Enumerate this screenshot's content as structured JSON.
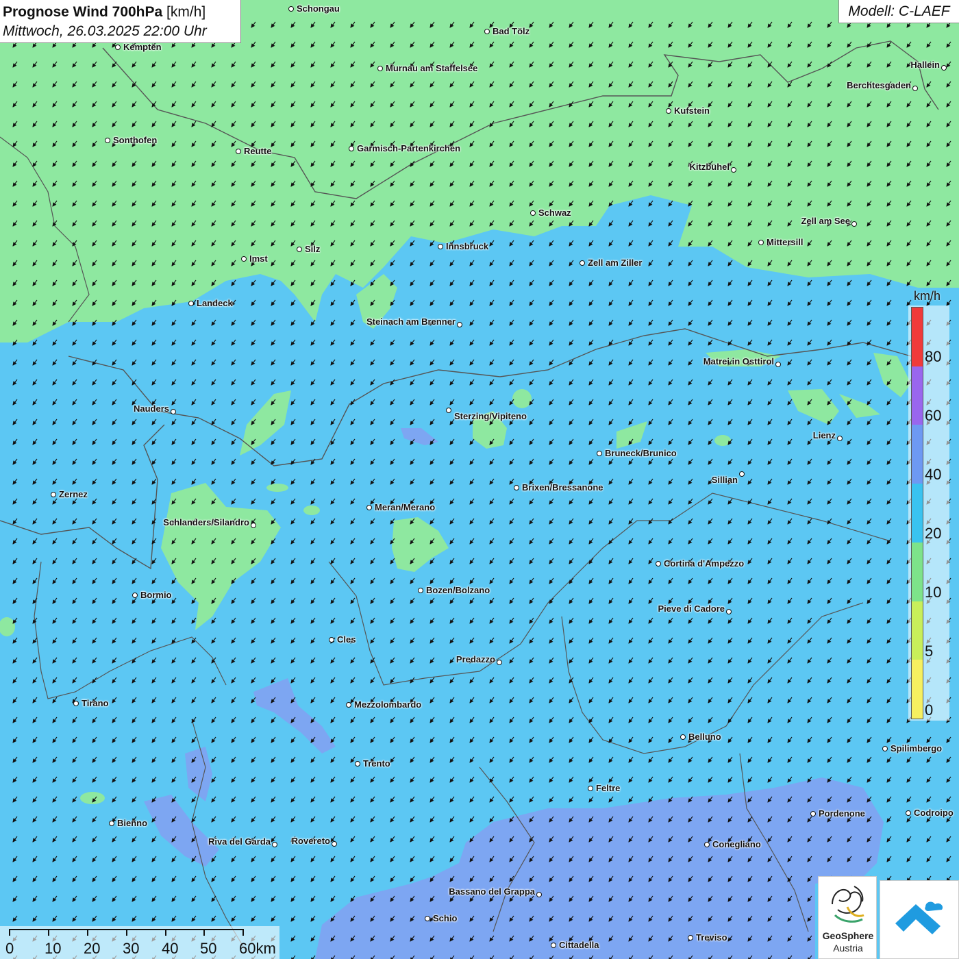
{
  "header": {
    "title_bold": "Prognose Wind 700hPa",
    "title_unit": "[km/h]",
    "datetime": "Mittwoch, 26.03.2025 22:00 Uhr",
    "model": "Modell: C-LAEF"
  },
  "legend": {
    "unit": "km/h",
    "ticks": [
      "80",
      "60",
      "40",
      "20",
      "10",
      "5",
      "0"
    ],
    "colors": [
      "#f03a3a",
      "#9966ee",
      "#6d99f3",
      "#39c3f0",
      "#7de38a",
      "#c8ef5a",
      "#f6f060"
    ]
  },
  "scale_bar": {
    "ticks": [
      "0",
      "10",
      "20",
      "30",
      "40",
      "50",
      "60km"
    ]
  },
  "cities": [
    {
      "id": "schongau",
      "name": "Schongau"
    },
    {
      "id": "bad-toelz",
      "name": "Bad Tölz"
    },
    {
      "id": "kempten",
      "name": "Kempten"
    },
    {
      "id": "murnau",
      "name": "Murnau am Staffelsee"
    },
    {
      "id": "hallein",
      "name": "Hallein"
    },
    {
      "id": "berchtesgaden",
      "name": "Berchtesgaden"
    },
    {
      "id": "kufstein",
      "name": "Kufstein"
    },
    {
      "id": "sonthofen",
      "name": "Sonthofen"
    },
    {
      "id": "reutte",
      "name": "Reutte"
    },
    {
      "id": "garmisch",
      "name": "Garmisch-Partenkirchen"
    },
    {
      "id": "kitzbuehel",
      "name": "Kitzbühel"
    },
    {
      "id": "schwaz",
      "name": "Schwaz"
    },
    {
      "id": "zell-am-see",
      "name": "Zell am See"
    },
    {
      "id": "mittersill",
      "name": "Mittersill"
    },
    {
      "id": "innsbruck",
      "name": "Innsbruck"
    },
    {
      "id": "imst",
      "name": "Imst"
    },
    {
      "id": "silz",
      "name": "Silz"
    },
    {
      "id": "zell-am-ziller",
      "name": "Zell am Ziller"
    },
    {
      "id": "landeck",
      "name": "Landeck"
    },
    {
      "id": "steinach",
      "name": "Steinach am Brenner"
    },
    {
      "id": "matrei",
      "name": "Matrei in Osttirol"
    },
    {
      "id": "nauders",
      "name": "Nauders"
    },
    {
      "id": "sterzing",
      "name": "Sterzing/Vipiteno"
    },
    {
      "id": "lienz",
      "name": "Lienz"
    },
    {
      "id": "bruneck",
      "name": "Bruneck/Brunico"
    },
    {
      "id": "sillian",
      "name": "Sillian"
    },
    {
      "id": "zernez",
      "name": "Zernez"
    },
    {
      "id": "brixen",
      "name": "Brixen/Bressanone"
    },
    {
      "id": "meran",
      "name": "Meran/Merano"
    },
    {
      "id": "schlanders",
      "name": "Schlanders/Silandro"
    },
    {
      "id": "cortina",
      "name": "Cortina d'Ampezzo"
    },
    {
      "id": "bozen",
      "name": "Bozen/Bolzano"
    },
    {
      "id": "bormio",
      "name": "Bormio"
    },
    {
      "id": "pieve",
      "name": "Pieve di Cadore"
    },
    {
      "id": "cles",
      "name": "Cles"
    },
    {
      "id": "predazzo",
      "name": "Predazzo"
    },
    {
      "id": "tirano",
      "name": "Tirano"
    },
    {
      "id": "mezzolombardo",
      "name": "Mezzolombardo"
    },
    {
      "id": "belluno",
      "name": "Belluno"
    },
    {
      "id": "spilimbergo",
      "name": "Spilimbergo"
    },
    {
      "id": "trento",
      "name": "Trento"
    },
    {
      "id": "feltre",
      "name": "Feltre"
    },
    {
      "id": "pordenone",
      "name": "Pordenone"
    },
    {
      "id": "codroipo",
      "name": "Codroipo"
    },
    {
      "id": "bienno",
      "name": "Bienno"
    },
    {
      "id": "riva",
      "name": "Riva del Garda"
    },
    {
      "id": "rovereto",
      "name": "Rovereto"
    },
    {
      "id": "conegliano",
      "name": "Conegliano"
    },
    {
      "id": "bassano",
      "name": "Bassano del Grappa"
    },
    {
      "id": "schio",
      "name": "Schio"
    },
    {
      "id": "treviso",
      "name": "Treviso"
    },
    {
      "id": "cittadella",
      "name": "Cittadella"
    }
  ],
  "logos": {
    "geosphere_name": "GeoSphere",
    "geosphere_sub": "Austria"
  }
}
